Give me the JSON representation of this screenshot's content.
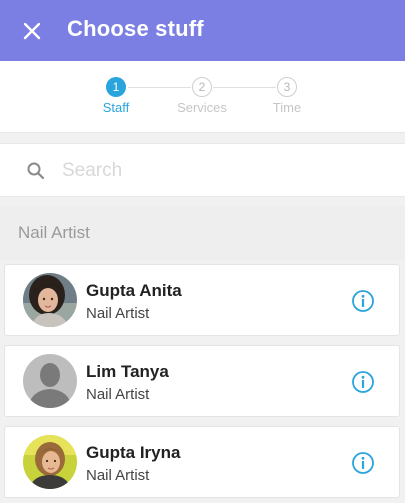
{
  "header": {
    "title": "Choose stuff",
    "close_icon": "close-icon",
    "background": "#7b7fe3"
  },
  "stepper": {
    "steps": [
      {
        "number": "1",
        "label": "Staff",
        "state": "active"
      },
      {
        "number": "2",
        "label": "Services",
        "state": "inactive"
      },
      {
        "number": "3",
        "label": "Time",
        "state": "inactive"
      }
    ],
    "active_color": "#2aa4dc"
  },
  "search": {
    "placeholder": "Search",
    "value": "",
    "icon": "search-icon"
  },
  "section": {
    "title": "Nail Artist"
  },
  "staff": [
    {
      "name": "Gupta Anita",
      "role": "Nail Artist",
      "avatar": "photo-woman-dark-hair",
      "info_icon": "info-icon"
    },
    {
      "name": "Lim Tanya",
      "role": "Nail Artist",
      "avatar": "default-person-avatar",
      "info_icon": "info-icon"
    },
    {
      "name": "Gupta Iryna",
      "role": "Nail Artist",
      "avatar": "photo-woman-light-hair",
      "info_icon": "info-icon"
    }
  ]
}
